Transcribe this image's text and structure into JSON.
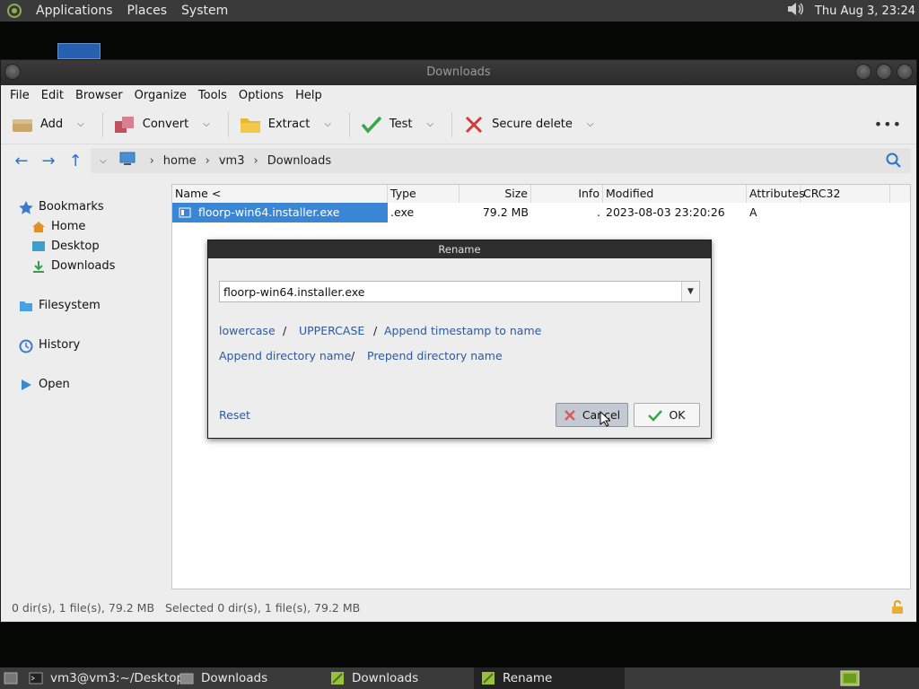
{
  "top_panel": {
    "menus": [
      "Applications",
      "Places",
      "System"
    ],
    "clock": "Thu Aug  3, 23:24"
  },
  "window": {
    "title": "Downloads",
    "menubar": [
      "File",
      "Edit",
      "Browser",
      "Organize",
      "Tools",
      "Options",
      "Help"
    ],
    "toolbar": {
      "add": "Add",
      "convert": "Convert",
      "extract": "Extract",
      "test": "Test",
      "secure_delete": "Secure delete",
      "more": "•••"
    },
    "path": [
      "home",
      "vm3",
      "Downloads"
    ]
  },
  "sidebar": {
    "bookmarks": "Bookmarks",
    "items": [
      "Home",
      "Desktop",
      "Downloads"
    ],
    "filesystem": "Filesystem",
    "history": "History",
    "open": "Open"
  },
  "file_list": {
    "columns": [
      "Name <",
      "Type",
      "Size",
      "Info",
      "Modified",
      "Attributes",
      "CRC32"
    ],
    "rows": [
      {
        "name": "floorp-win64.installer.exe",
        "type": ".exe",
        "size": "79.2 MB",
        "info": ".",
        "modified": "2023-08-03 23:20:26",
        "attributes": "A",
        "crc32": ""
      }
    ]
  },
  "status": {
    "left": "0 dir(s), 1 file(s), 79.2 MB",
    "selected": "Selected 0 dir(s), 1 file(s), 79.2 MB"
  },
  "rename_dialog": {
    "title": "Rename",
    "value": "floorp-win64.installer.exe",
    "links": {
      "lowercase": "lowercase",
      "uppercase": "UPPERCASE",
      "append_timestamp": "Append timestamp to name",
      "append_dir": "Append directory name",
      "prepend_dir": "Prepend directory name",
      "reset": "Reset"
    },
    "separator": "/",
    "cancel": "Cancel",
    "ok": "OK"
  },
  "taskbar": {
    "tasks": [
      "vm3@vm3:~/Desktop",
      "Downloads",
      "Downloads",
      "Rename"
    ]
  }
}
